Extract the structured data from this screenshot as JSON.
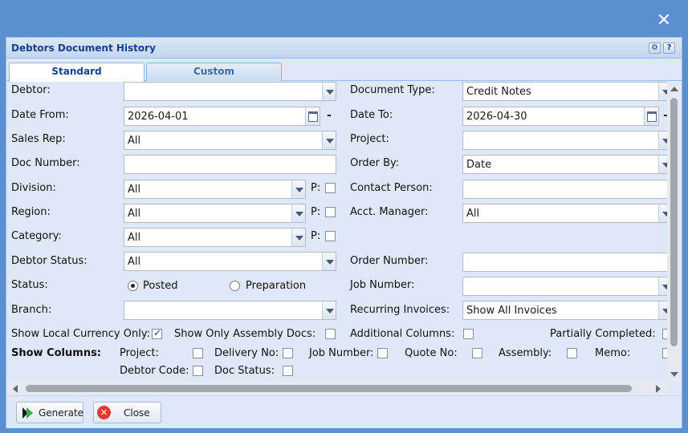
{
  "window": {
    "title": "Debtors Document History",
    "tools": {
      "gear": "⚙",
      "help": "?"
    }
  },
  "outer_close": "✕",
  "tabs": [
    {
      "label": "Standard",
      "active": true
    },
    {
      "label": "Custom",
      "active": false
    }
  ],
  "form": {
    "debtor": {
      "label": "Debtor:",
      "value": ""
    },
    "document_type": {
      "label": "Document Type:",
      "value": "Credit Notes"
    },
    "date_from": {
      "label": "Date From:",
      "value": "2026-04-01",
      "clear": "-"
    },
    "date_to": {
      "label": "Date To:",
      "value": "2026-04-30",
      "clear": "-"
    },
    "sales_rep": {
      "label": "Sales Rep:",
      "value": "All"
    },
    "project": {
      "label": "Project:",
      "value": ""
    },
    "doc_number": {
      "label": "Doc Number:",
      "value": ""
    },
    "order_by": {
      "label": "Order By:",
      "value": "Date"
    },
    "division": {
      "label": "Division:",
      "value": "All",
      "p_label": "P:"
    },
    "contact_person": {
      "label": "Contact Person:",
      "value": ""
    },
    "region": {
      "label": "Region:",
      "value": "All",
      "p_label": "P:"
    },
    "acct_manager": {
      "label": "Acct. Manager:",
      "value": "All"
    },
    "category": {
      "label": "Category:",
      "value": "All",
      "p_label": "P:"
    },
    "debtor_status": {
      "label": "Debtor Status:",
      "value": "All"
    },
    "order_number": {
      "label": "Order Number:",
      "value": ""
    },
    "status": {
      "label": "Status:",
      "options": [
        "Posted",
        "Preparation"
      ],
      "selected": "Posted"
    },
    "job_number": {
      "label": "Job Number:",
      "value": ""
    },
    "branch": {
      "label": "Branch:",
      "value": ""
    },
    "recurring_invoices": {
      "label": "Recurring Invoices:",
      "value": "Show All Invoices"
    },
    "show_local_currency": {
      "label": "Show Local Currency Only:",
      "checked": true
    },
    "show_assembly_docs": {
      "label": "Show Only Assembly Docs:",
      "checked": false
    },
    "additional_columns": {
      "label": "Additional Columns:",
      "checked": false
    },
    "partially_completed": {
      "label": "Partially Completed:",
      "checked": false
    }
  },
  "show_columns": {
    "label": "Show Columns:",
    "items": [
      "Project:",
      "Delivery No:",
      "Job Number:",
      "Quote No:",
      "Assembly:",
      "Memo:"
    ],
    "row2": [
      "Debtor Code:",
      "Doc Status:"
    ]
  },
  "footer": {
    "generate_label": "Generate",
    "close_label": "Close"
  }
}
